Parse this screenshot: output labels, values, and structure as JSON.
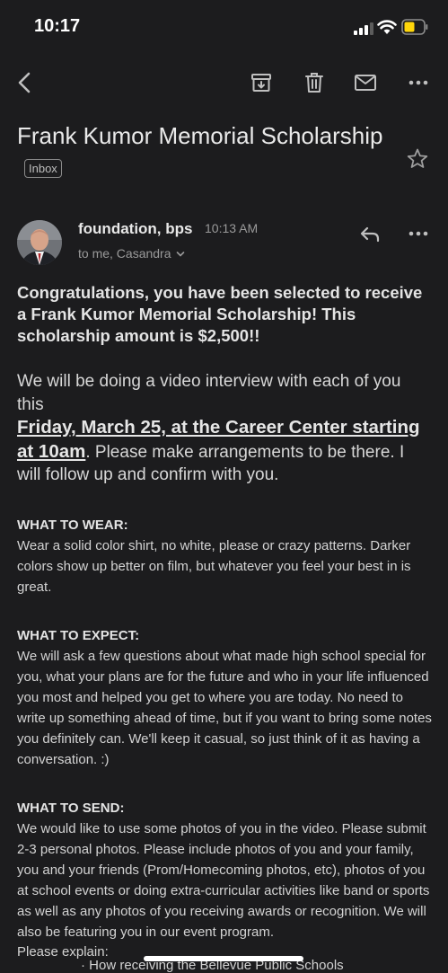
{
  "status": {
    "time": "10:17"
  },
  "email": {
    "subject": "Frank Kumor Memorial Scholarship",
    "label": "Inbox",
    "sender": "foundation, bps",
    "time": "10:13 AM",
    "recipients": "to me, Casandra",
    "headline": "Congratulations, you have been selected to receive a Frank Kumor Memorial Scholarship! This scholarship amount is $2,500!!",
    "para1_start": "We will be doing a video interview with each of you this",
    "para1_highlight": "Friday, March 25, at the Career Center starting at 10am",
    "para1_end": ".  Please make arrangements to be there.  I will follow up and confirm with you.",
    "sections": {
      "wear_title": "WHAT TO WEAR:",
      "wear_text": "Wear a solid color shirt, no white, please or crazy patterns. Darker colors show up better on film, but whatever you feel your best in is great.",
      "expect_title": "WHAT TO EXPECT:",
      "expect_text": "We will ask a few questions about what made high school special for you, what your plans are for the future and who in your life influenced you most and helped you get to where you are today. No need to write up something ahead of time, but if you want to bring some notes you definitely can. We'll keep it casual, so just think of it as having a conversation. :)",
      "send_title": "WHAT TO SEND:",
      "send_text": "We would like to use some photos of you in the video. Please submit 2-3 personal photos. Please include photos of you and your family, you and your friends (Prom/Homecoming photos, etc), photos of you at school events or doing extra-curricular activities like band or sports as well as any photos of you receiving awards or recognition. We will also be featuring you in our event program.",
      "explain_label": "Please explain:",
      "truncated": "· How receiving the Bellevue Public Schools"
    }
  },
  "icons": {
    "back": "chevron-left-icon",
    "archive": "archive-icon",
    "trash": "trash-icon",
    "mail": "mail-icon",
    "more": "more-horizontal-icon",
    "star": "star-outline-icon",
    "reply": "reply-icon",
    "avatar": "avatar"
  },
  "colors": {
    "background": "#1c1c1e",
    "text": "#e6e6e6",
    "muted": "#9a9a9a",
    "battery": "#ffd60a"
  }
}
